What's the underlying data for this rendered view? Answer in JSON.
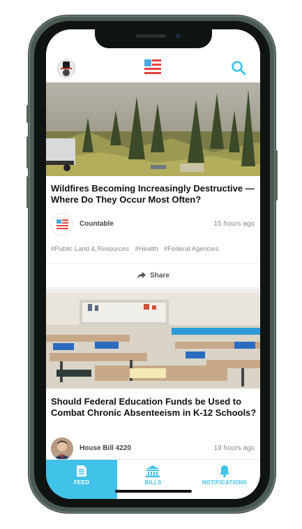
{
  "header": {
    "logo_icon": "flag-logo-icon",
    "search_icon": "search-icon",
    "avatar_icon": "uncle-sam-avatar-icon"
  },
  "feed": [
    {
      "image_icon": "wildfire-photo",
      "headline": "Wildfires Becoming Increasingly Destructive — Where Do They Occur Most Often?",
      "source": "Countable",
      "time": "15 hours ago",
      "tags": [
        "#Public Land & Resources",
        "#Health",
        "#Federal Agencies"
      ],
      "share_label": "Share"
    },
    {
      "image_icon": "classroom-photo",
      "headline": "Should Federal Education Funds be Used to Combat Chronic Absenteeism in K-12 Schools?",
      "source": "House Bill 4220",
      "time": "19 hours ago"
    }
  ],
  "tabs": [
    {
      "label": "FEED",
      "icon": "feed-icon",
      "active": true
    },
    {
      "label": "BILLS",
      "icon": "capitol-icon",
      "active": false
    },
    {
      "label": "NOTIFICATIONS",
      "icon": "bell-icon",
      "active": false
    }
  ],
  "colors": {
    "accent": "#40c2e9",
    "flag_red": "#e5413d",
    "flag_blue": "#4aa8e0",
    "phone_frame": "#4b5a52"
  }
}
